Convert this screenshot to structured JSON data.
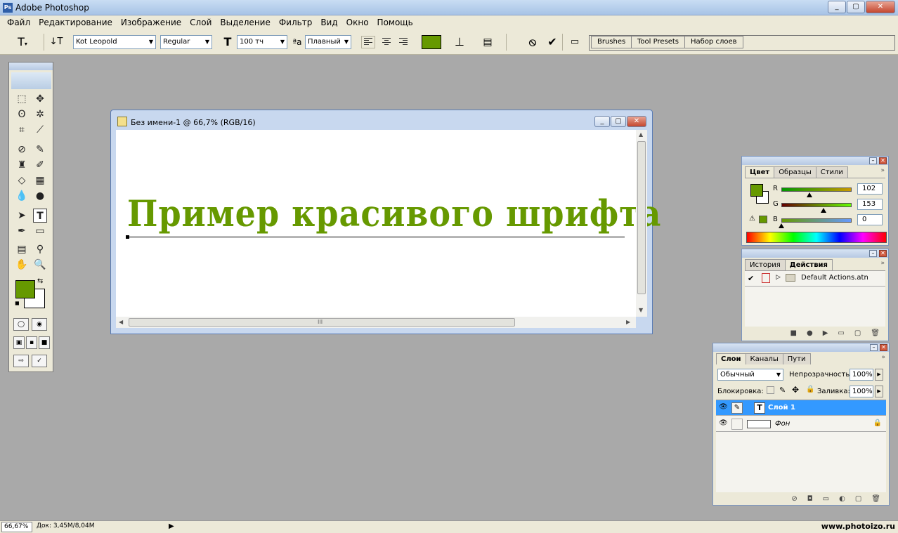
{
  "window": {
    "title": "Adobe Photoshop",
    "buttons": [
      "_",
      "▢",
      "✕"
    ]
  },
  "menu": [
    "Файл",
    "Редактирование",
    "Изображение",
    "Слой",
    "Выделение",
    "Фильтр",
    "Вид",
    "Окно",
    "Помощь"
  ],
  "options": {
    "font_family": "Kot Leopold",
    "font_style": "Regular",
    "font_size": "100 тч",
    "aa_glyph": "a",
    "anti_alias": "Плавный",
    "text_color": "#669900",
    "well_tabs": [
      "Brushes",
      "Tool Presets",
      "Набор слоев"
    ]
  },
  "toolbox": {
    "foreground": "#669900",
    "background": "#ffffff"
  },
  "document": {
    "title": "Без имени-1 @ 66,7% (RGB/16)",
    "sample_text": "Пример красивого шрифта",
    "text_color": "#669900",
    "hscroll_grip": "III"
  },
  "color_palette": {
    "tabs": [
      "Цвет",
      "Образцы",
      "Стили"
    ],
    "channels": [
      {
        "label": "R",
        "value": "102",
        "fraction": 0.4
      },
      {
        "label": "G",
        "value": "153",
        "fraction": 0.6
      },
      {
        "label": "B",
        "value": "0",
        "fraction": 0.0
      }
    ],
    "swatch": "#669900"
  },
  "actions_palette": {
    "tabs": [
      "История",
      "Действия"
    ],
    "item": "Default Actions.atn"
  },
  "layers_palette": {
    "tabs": [
      "Слои",
      "Каналы",
      "Пути"
    ],
    "blend_mode": "Обычный",
    "opacity_label": "Непрозрачность:",
    "opacity": "100%",
    "lock_label": "Блокировка:",
    "fill_label": "Заливка:",
    "fill": "100%",
    "layers": [
      {
        "name": "Слой 1",
        "type": "T",
        "selected": true
      },
      {
        "name": "Фон",
        "type": "",
        "selected": false
      }
    ]
  },
  "status": {
    "zoom": "66,67%",
    "doc_info": "Док: 3,45M/8,04M",
    "site": "www.photoizo.ru"
  },
  "colors": {
    "accent": "#669900",
    "selection": "#3399ff"
  }
}
